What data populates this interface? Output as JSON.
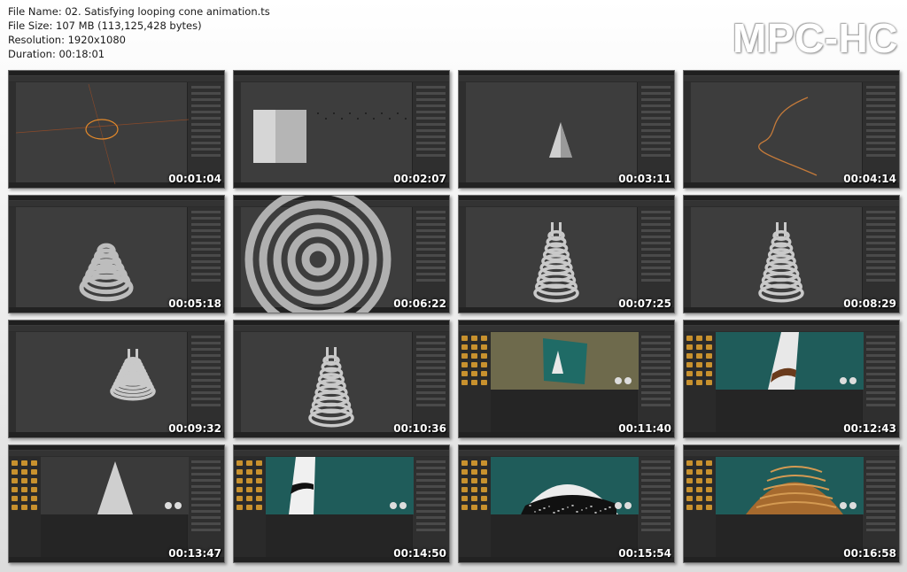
{
  "file_info": {
    "name_line": "File Name: 02. Satisfying looping cone animation.ts",
    "size_line": "File Size: 107 MB (113,125,428 bytes)",
    "resolution_line": "Resolution: 1920x1080",
    "duration_line": "Duration: 00:18:01"
  },
  "logo": "MPC-HC",
  "thumbnails": [
    {
      "time": "00:01:04",
      "scene": "circle"
    },
    {
      "time": "00:02:07",
      "scene": "cylinder"
    },
    {
      "time": "00:03:11",
      "scene": "cone"
    },
    {
      "time": "00:04:14",
      "scene": "curve"
    },
    {
      "time": "00:05:18",
      "scene": "spiral-cone"
    },
    {
      "time": "00:06:22",
      "scene": "spiral-top"
    },
    {
      "time": "00:07:25",
      "scene": "coil-cone"
    },
    {
      "time": "00:08:29",
      "scene": "coil-cone-tilt"
    },
    {
      "time": "00:09:32",
      "scene": "coil-timeline"
    },
    {
      "time": "00:10:36",
      "scene": "coil-render"
    },
    {
      "time": "00:11:40",
      "scene": "shader-plane"
    },
    {
      "time": "00:12:43",
      "scene": "shader-closeup"
    },
    {
      "time": "00:13:47",
      "scene": "shader-cone"
    },
    {
      "time": "00:14:50",
      "scene": "shader-stripes"
    },
    {
      "time": "00:15:54",
      "scene": "shader-sprinkles"
    },
    {
      "time": "00:16:58",
      "scene": "shader-caramel"
    }
  ]
}
